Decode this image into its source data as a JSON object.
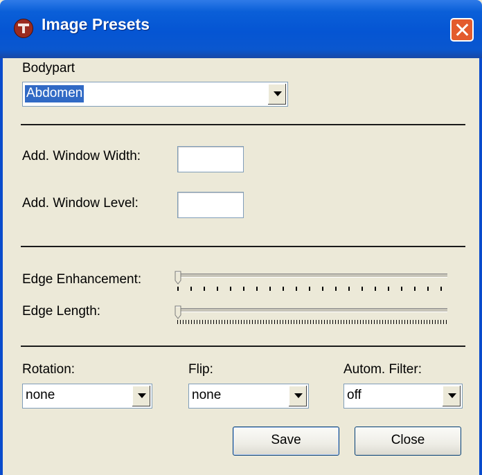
{
  "window": {
    "title": "Image Presets",
    "app_icon": "app-icon",
    "close_icon": "close-icon"
  },
  "bodypart": {
    "label": "Bodypart",
    "value": "Abdomen"
  },
  "window_width": {
    "label": "Add. Window Width:",
    "value": ""
  },
  "window_level": {
    "label": "Add. Window Level:",
    "value": ""
  },
  "edge_enhancement": {
    "label": "Edge Enhancement:",
    "level": 0
  },
  "edge_length": {
    "label": "Edge Length:",
    "level": 0
  },
  "rotation": {
    "label": "Rotation:",
    "value": "none"
  },
  "flip": {
    "label": "Flip:",
    "value": "none"
  },
  "autom_filter": {
    "label": "Autom. Filter:",
    "value": "off"
  },
  "buttons": {
    "save": "Save",
    "close": "Close"
  },
  "colors": {
    "titlebar": "#0555d3",
    "dialog_bg": "#ece9d8",
    "selection": "#316ac5",
    "close_button": "#e35b2e"
  }
}
